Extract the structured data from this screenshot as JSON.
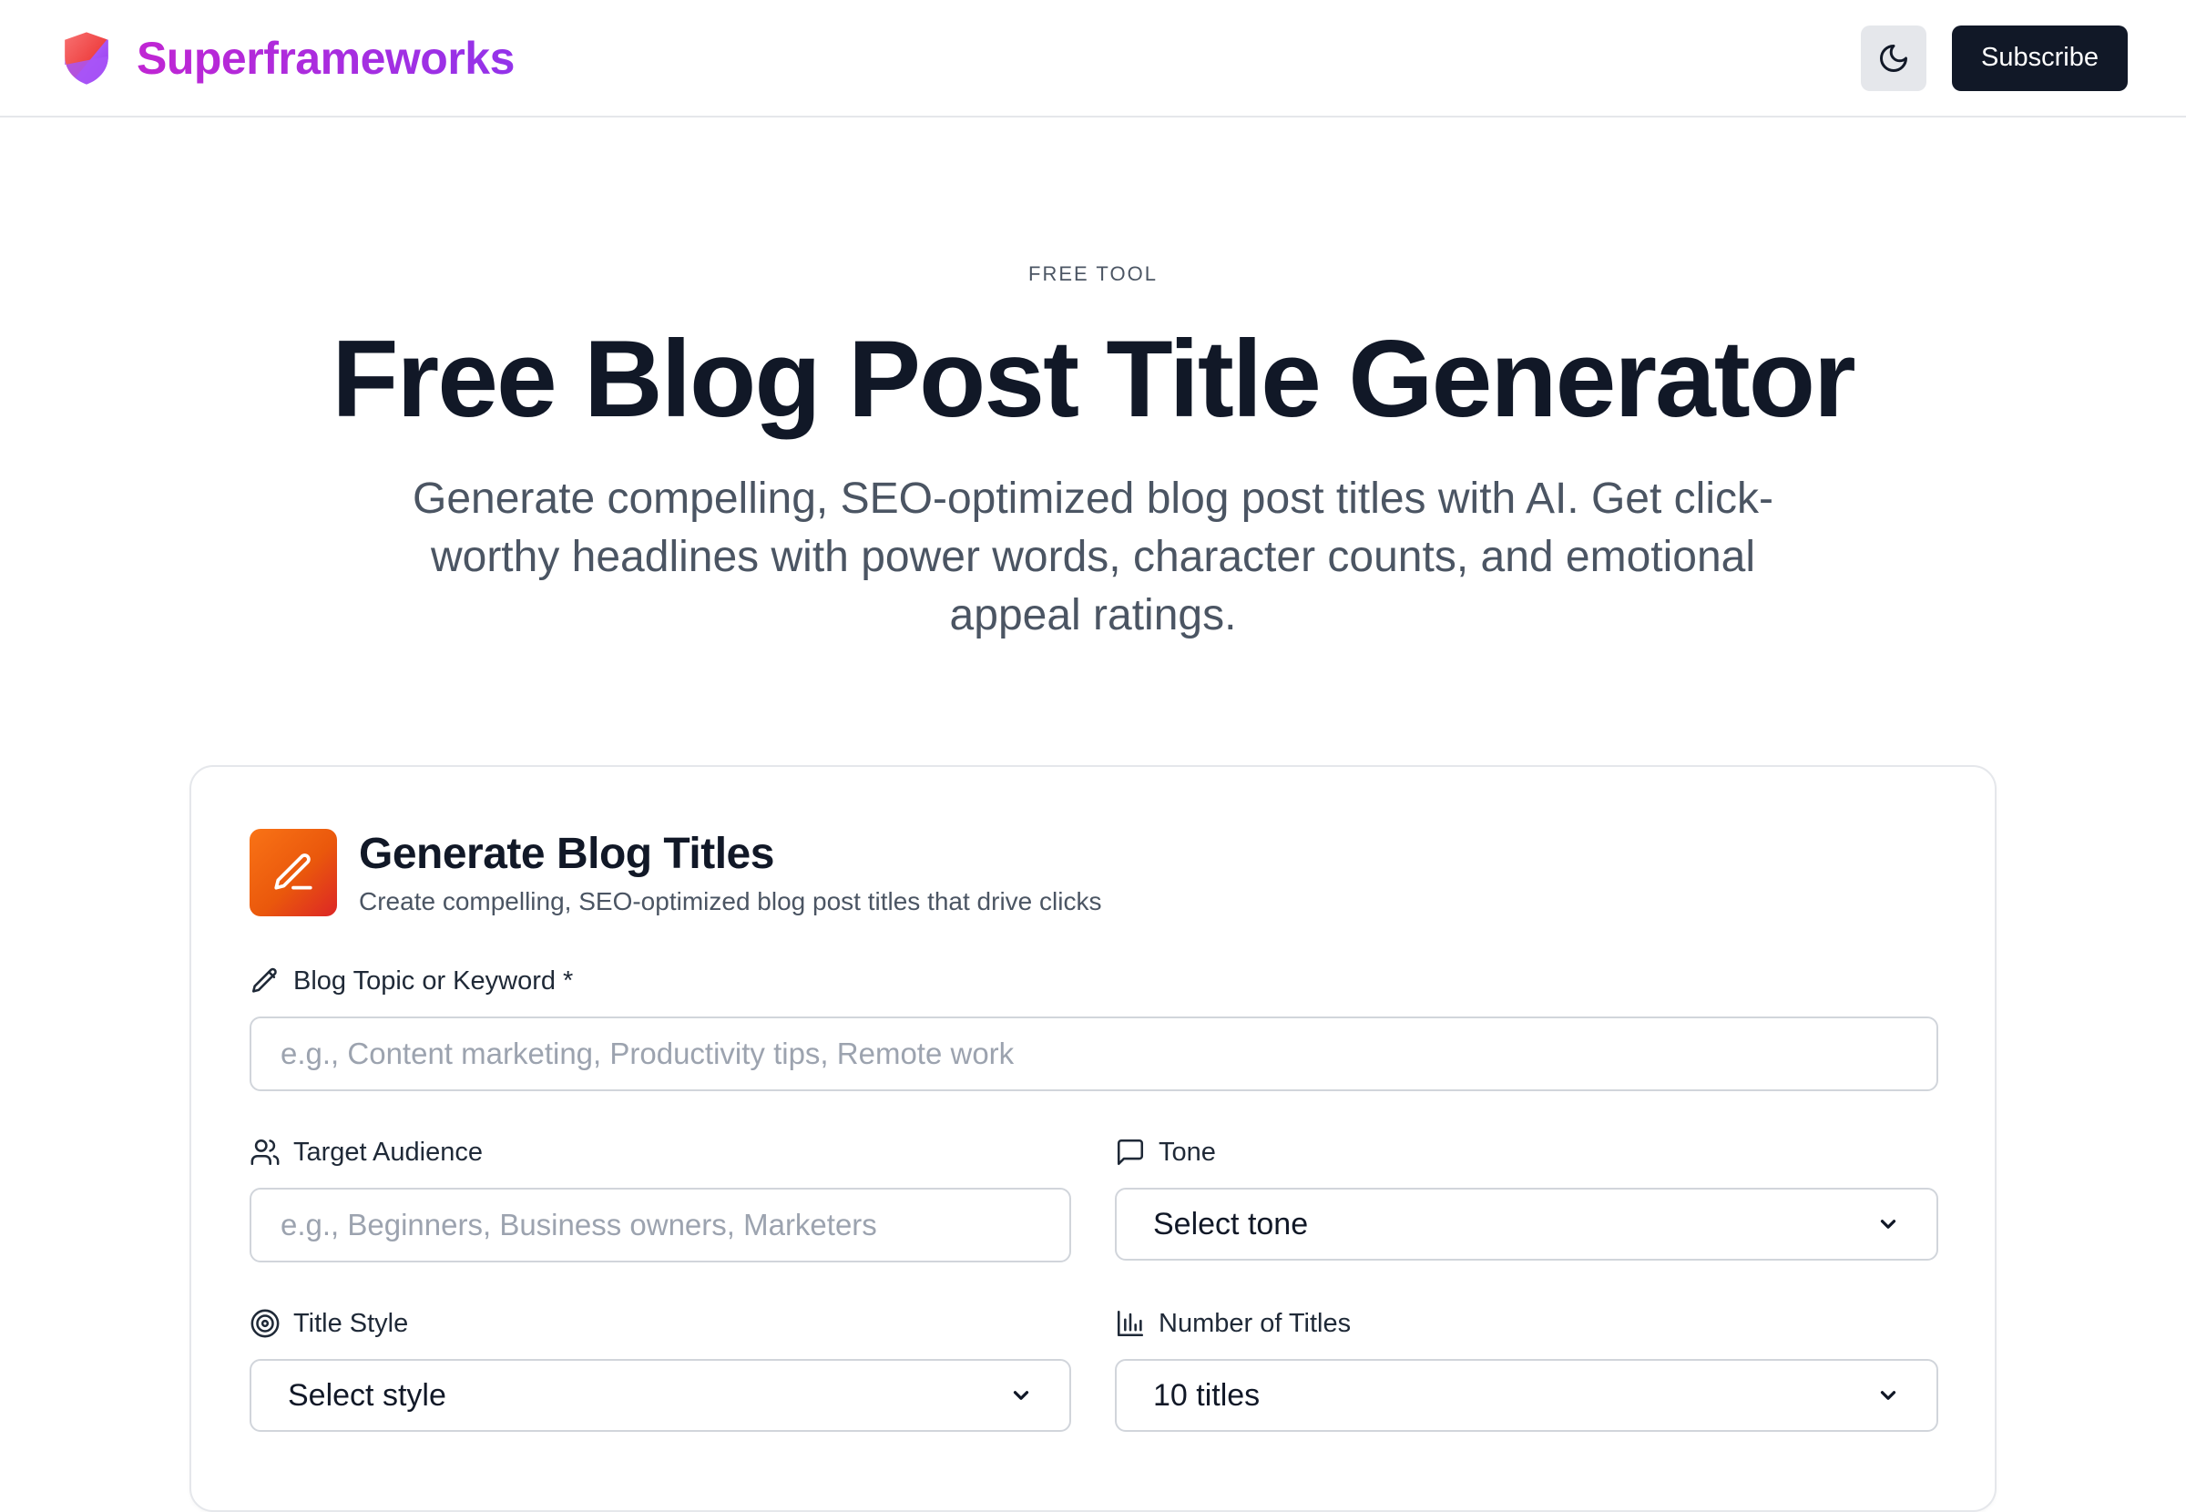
{
  "header": {
    "brand_name": "Superframeworks",
    "subscribe_label": "Subscribe"
  },
  "hero": {
    "eyebrow": "FREE TOOL",
    "title": "Free Blog Post Title Generator",
    "subtitle": "Generate compelling, SEO-optimized blog post titles with AI. Get click-worthy headlines with power words, character counts, and emotional appeal ratings."
  },
  "card": {
    "title": "Generate Blog Titles",
    "description": "Create compelling, SEO-optimized blog post titles that drive clicks",
    "fields": {
      "topic": {
        "label": "Blog Topic or Keyword *",
        "value": "",
        "placeholder": "e.g., Content marketing, Productivity tips, Remote work"
      },
      "audience": {
        "label": "Target Audience",
        "value": "",
        "placeholder": "e.g., Beginners, Business owners, Marketers"
      },
      "tone": {
        "label": "Tone",
        "selected": "Select tone"
      },
      "style": {
        "label": "Title Style",
        "selected": "Select style"
      },
      "count": {
        "label": "Number of Titles",
        "selected": "10 titles"
      }
    }
  },
  "icons": {
    "brand": "shield-icon",
    "theme_toggle": "moon-icon",
    "card": "pen-icon",
    "topic": "pencil-icon",
    "audience": "users-icon",
    "tone": "message-square-icon",
    "style": "target-icon",
    "count": "bar-chart-icon",
    "select": "chevron-down-icon"
  },
  "colors": {
    "brand_gradient_start": "#c026d3",
    "brand_gradient_end": "#9333ea",
    "primary_dark": "#111827",
    "card_icon_start": "#f97316",
    "card_icon_end": "#dc2626",
    "shield_top": "#ef4444",
    "shield_bottom": "#a855f7"
  }
}
